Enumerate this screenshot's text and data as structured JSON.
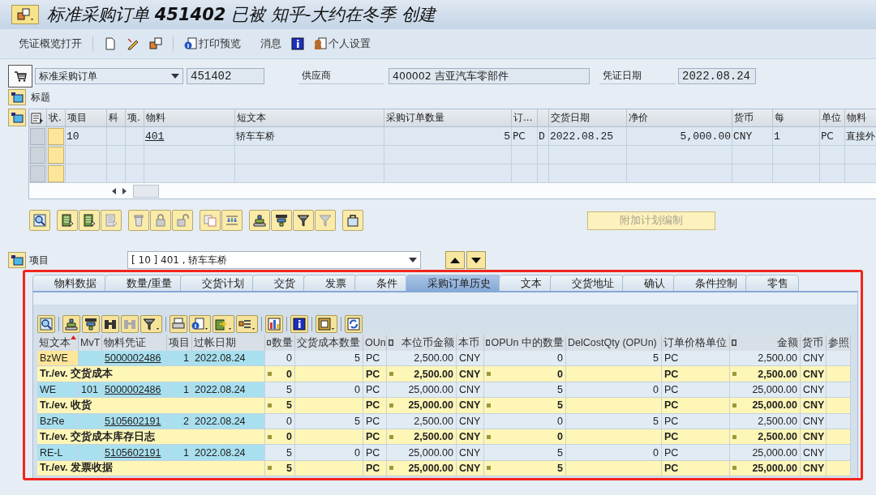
{
  "window": {
    "title": "标准采购订单 **451402** 已被 知乎-大约在冬季 创建"
  },
  "toolbar": [
    "凭证概览打开",
    "打印预览",
    "消息",
    "个人设置"
  ],
  "header": {
    "doc_type": "标准采购订单",
    "po_number": "451402",
    "vendor_label": "供应商",
    "vendor": "400002 吉亚汽车零部件",
    "date_label": "凭证日期",
    "date": "2022.08.24"
  },
  "header_section": {
    "label": "标题"
  },
  "items_table": {
    "columns": [
      "状.",
      "项目",
      "科",
      "项.",
      "物料",
      "短文本",
      "采购订单数量",
      "订...",
      "交货日期",
      "净价",
      "货币",
      "每",
      "单位",
      "物料"
    ],
    "rows": [
      {
        "item": "10",
        "material": "401",
        "short_text": "轿车车桥",
        "quantity": "5",
        "order_unit": "PC",
        "column_9": "D",
        "delivery_date": "2022.08.25",
        "net_price": "5,000.00",
        "currency": "CNY",
        "per": "1",
        "unit": "PC",
        "material_group": "直接外"
      }
    ]
  },
  "attach_button": {
    "label": "附加计划编制",
    "disabled": true
  },
  "item_selector": {
    "label": "项目",
    "value": "[ 10 ] 401 , 轿车车桥"
  },
  "tabs": [
    {
      "label": "物料数据",
      "selected": false
    },
    {
      "label": "数量/重量",
      "selected": false
    },
    {
      "label": "交货计划",
      "selected": false
    },
    {
      "label": "交货",
      "selected": false
    },
    {
      "label": "发票",
      "selected": false
    },
    {
      "label": "条件",
      "selected": false
    },
    {
      "label": "采购订单历史",
      "selected": true
    },
    {
      "label": "文本",
      "selected": false
    },
    {
      "label": "交货地址",
      "selected": false
    },
    {
      "label": "确认",
      "selected": false
    },
    {
      "label": "条件控制",
      "selected": false
    },
    {
      "label": "零售",
      "selected": false
    }
  ],
  "history": {
    "columns": [
      {
        "label": "短文本",
        "sum": false,
        "sorted": true
      },
      {
        "label": "MvT",
        "sum": false,
        "sorted": false
      },
      {
        "label": "物料凭证",
        "sum": false,
        "sorted": false
      },
      {
        "label": "项目",
        "sum": false,
        "sorted": false
      },
      {
        "label": "过帐日期",
        "sum": false,
        "sorted": false
      },
      {
        "label": "数量",
        "sum": true,
        "sorted": false
      },
      {
        "label": "交货成本数量",
        "sum": false,
        "sorted": false
      },
      {
        "label": "OUn",
        "sum": false,
        "sorted": false
      },
      {
        "label": "本位币金额",
        "sum": true,
        "sorted": false
      },
      {
        "label": "本币",
        "sum": false,
        "sorted": false
      },
      {
        "label": "OPUn 中的数量",
        "sum": true,
        "sorted": false
      },
      {
        "label": "DelCostQty (OPUn)",
        "sum": false,
        "sorted": false
      },
      {
        "label": "订单价格单位",
        "sum": false,
        "sorted": false
      },
      {
        "label": "金额",
        "sum": true,
        "sorted": false
      },
      {
        "label": "货币",
        "sum": false,
        "sorted": false
      },
      {
        "label": "参照",
        "sum": false,
        "sorted": false
      }
    ],
    "rows": [
      {
        "kind": "item",
        "selected": true,
        "short_text": "BzWE",
        "mat_doc": "5000002486",
        "item": "1",
        "posting_date": "2022.08.24",
        "qty": "0",
        "delcost_qty": "5",
        "oun": "PC",
        "local_amount": "2,500.00",
        "local_currency": "CNY",
        "opun_qty": "0",
        "delcost_opun": "5",
        "order_unit": "PC",
        "amount": "2,500.00",
        "currency": "CNY"
      },
      {
        "kind": "total",
        "label": "Tr./ev. 交货成本",
        "qty": "0",
        "oun": "PC",
        "local_amount": "2,500.00",
        "local_currency": "CNY",
        "opun_qty": "0",
        "order_unit": "PC",
        "amount": "2,500.00",
        "currency": "CNY"
      },
      {
        "kind": "item",
        "selected": false,
        "short_text": "WE",
        "mvt": "101",
        "mat_doc": "5000002486",
        "item": "1",
        "posting_date": "2022.08.24",
        "qty": "5",
        "delcost_qty": "0",
        "oun": "PC",
        "local_amount": "25,000.00",
        "local_currency": "CNY",
        "opun_qty": "5",
        "delcost_opun": "0",
        "order_unit": "PC",
        "amount": "25,000.00",
        "currency": "CNY"
      },
      {
        "kind": "total",
        "label": "Tr./ev. 收货",
        "qty": "5",
        "oun": "PC",
        "local_amount": "25,000.00",
        "local_currency": "CNY",
        "opun_qty": "5",
        "order_unit": "PC",
        "amount": "25,000.00",
        "currency": "CNY"
      },
      {
        "kind": "item",
        "selected": false,
        "short_text": "BzRe",
        "mat_doc": "5105602191",
        "item": "2",
        "posting_date": "2022.08.24",
        "qty": "0",
        "delcost_qty": "5",
        "oun": "PC",
        "local_amount": "2,500.00",
        "local_currency": "CNY",
        "opun_qty": "0",
        "delcost_opun": "5",
        "order_unit": "PC",
        "amount": "2,500.00",
        "currency": "CNY"
      },
      {
        "kind": "total",
        "label": "Tr./ev. 交货成本库存日志",
        "qty": "0",
        "oun": "PC",
        "local_amount": "2,500.00",
        "local_currency": "CNY",
        "opun_qty": "0",
        "order_unit": "PC",
        "amount": "2,500.00",
        "currency": "CNY"
      },
      {
        "kind": "item",
        "selected": false,
        "short_text": "RE-L",
        "mat_doc": "5105602191",
        "item": "1",
        "posting_date": "2022.08.24",
        "qty": "5",
        "delcost_qty": "0",
        "oun": "PC",
        "local_amount": "25,000.00",
        "local_currency": "CNY",
        "opun_qty": "5",
        "delcost_opun": "0",
        "order_unit": "PC",
        "amount": "25,000.00",
        "currency": "CNY"
      },
      {
        "kind": "total",
        "label": "Tr./ev. 发票收据",
        "qty": "5",
        "oun": "PC",
        "local_amount": "25,000.00",
        "local_currency": "CNY",
        "opun_qty": "5",
        "order_unit": "PC",
        "amount": "25,000.00",
        "currency": "CNY"
      }
    ]
  }
}
